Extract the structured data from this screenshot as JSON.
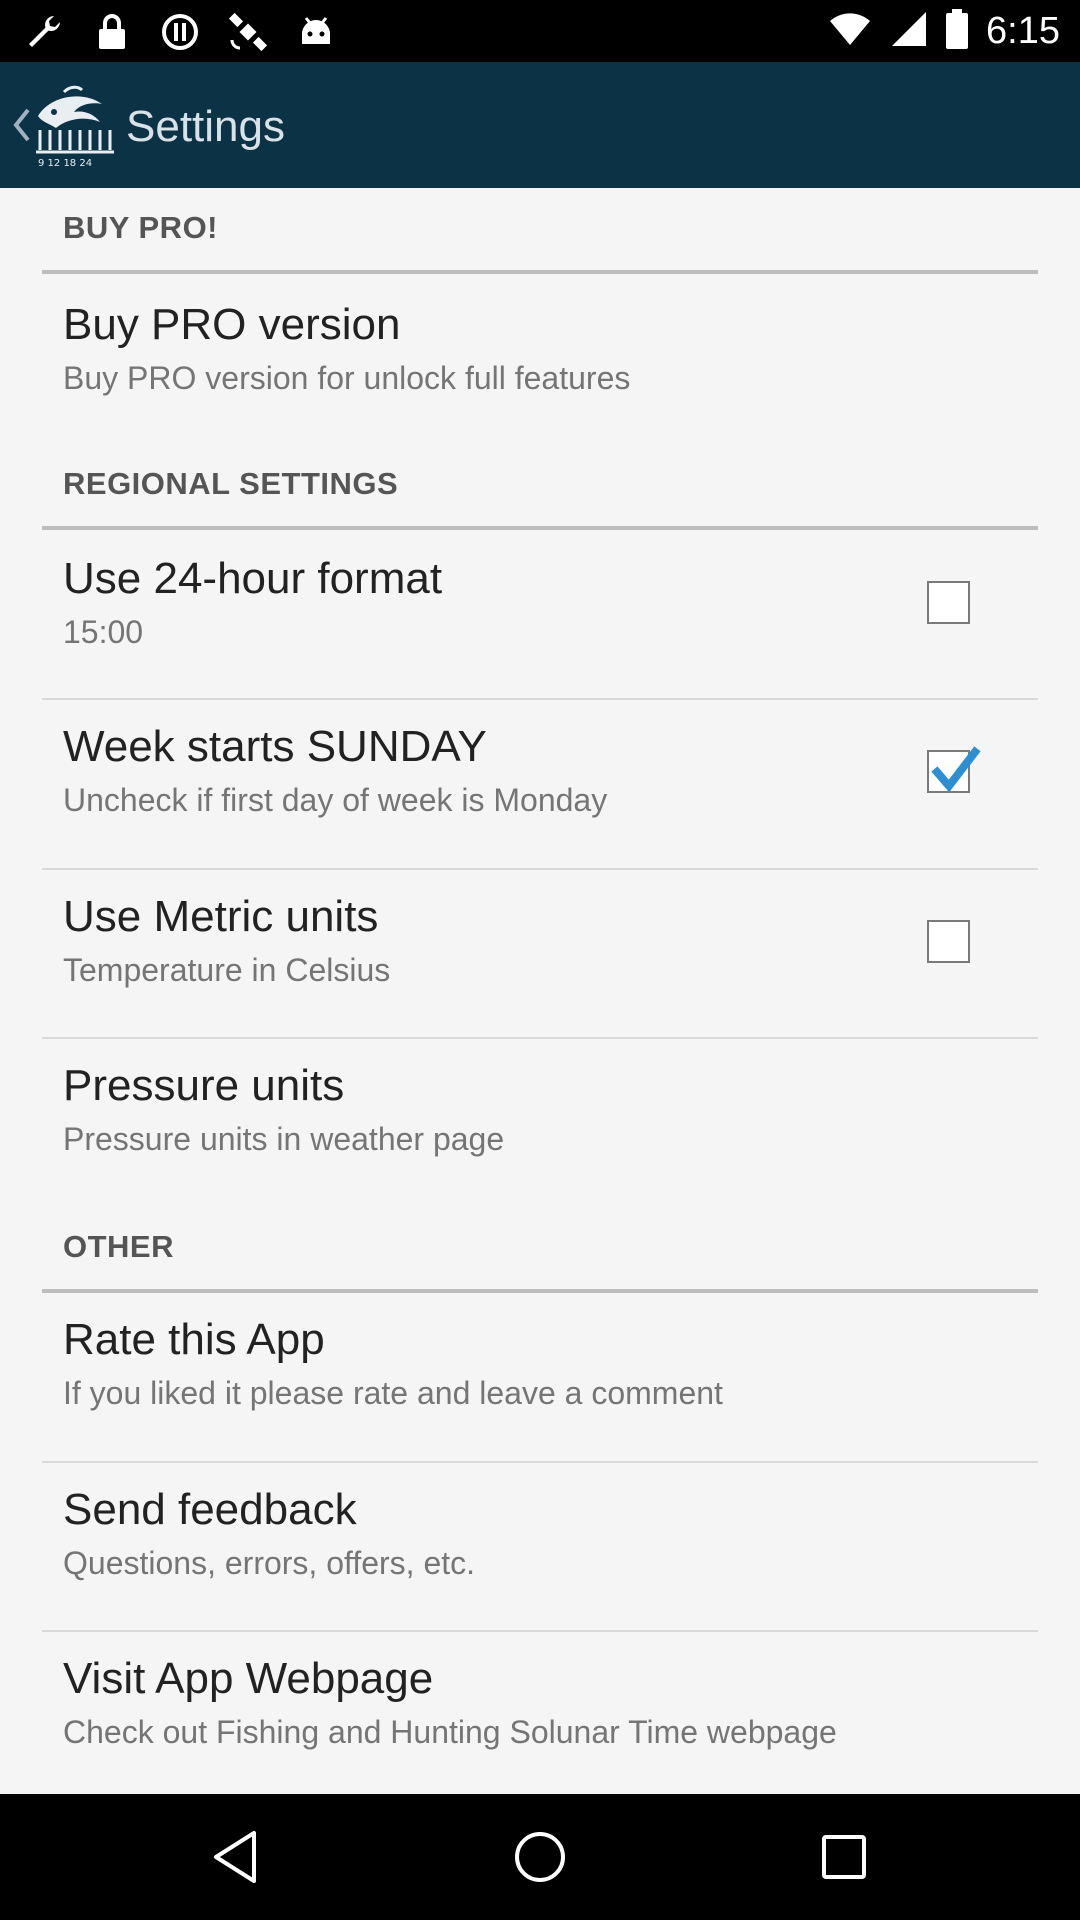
{
  "status_bar": {
    "time": "6:15",
    "left_icons": [
      "wrench-icon",
      "lock-icon",
      "alert-icon",
      "satellite-icon",
      "android-icon"
    ]
  },
  "app_bar": {
    "title": "Settings"
  },
  "sections": [
    {
      "header": "BUY PRO!",
      "items": [
        {
          "title": "Buy PRO version",
          "summary": "Buy PRO version for unlock full features"
        }
      ]
    },
    {
      "header": "REGIONAL SETTINGS",
      "items": [
        {
          "title": "Use 24-hour format",
          "summary": "15:00",
          "checked": false
        },
        {
          "title": "Week starts SUNDAY",
          "summary": "Uncheck if first day of week is Monday",
          "checked": true
        },
        {
          "title": "Use Metric units",
          "summary": "Temperature in Celsius",
          "checked": false
        },
        {
          "title": "Pressure units",
          "summary": "Pressure units in weather page"
        }
      ]
    },
    {
      "header": "OTHER",
      "items": [
        {
          "title": "Rate this App",
          "summary": "If you liked it please rate and leave a comment"
        },
        {
          "title": "Send feedback",
          "summary": "Questions, errors, offers, etc."
        },
        {
          "title": "Visit App Webpage",
          "summary": "Check out Fishing and Hunting Solunar Time webpage"
        }
      ]
    }
  ],
  "colors": {
    "app_bar": "#0c3345",
    "checkbox_accent": "#2e8fd0"
  }
}
